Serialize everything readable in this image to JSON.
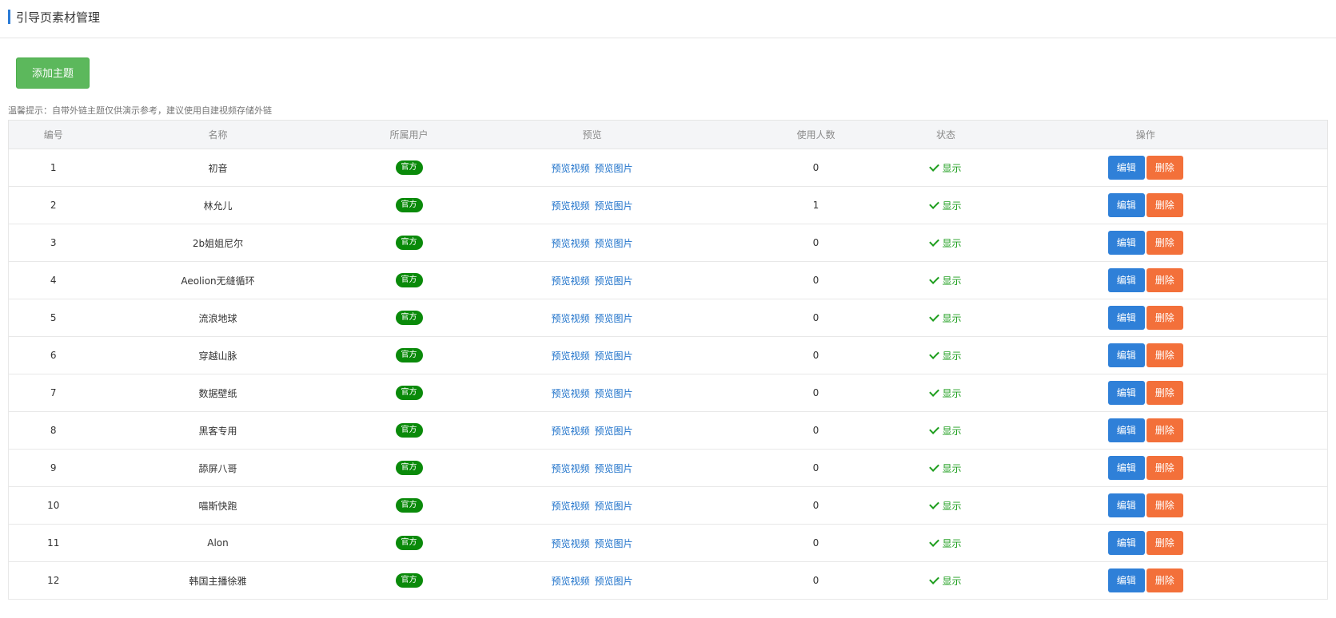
{
  "header": {
    "title": "引导页素材管理"
  },
  "toolbar": {
    "add_label": "添加主题"
  },
  "notice": "温馨提示：自带外链主题仅供演示参考，建议使用自建视频存储外链",
  "table": {
    "columns": [
      "编号",
      "名称",
      "所属用户",
      "预览",
      "使用人数",
      "状态",
      "操作"
    ],
    "rows": [
      {
        "id": "1",
        "name": "初音",
        "owner": "官方",
        "preview_video": "预览视频",
        "preview_image": "预览图片",
        "users": "0",
        "status": "显示",
        "edit": "编辑",
        "delete": "删除"
      },
      {
        "id": "2",
        "name": "林允儿",
        "owner": "官方",
        "preview_video": "预览视频",
        "preview_image": "预览图片",
        "users": "1",
        "status": "显示",
        "edit": "编辑",
        "delete": "删除"
      },
      {
        "id": "3",
        "name": "2b姐姐尼尔",
        "owner": "官方",
        "preview_video": "预览视频",
        "preview_image": "预览图片",
        "users": "0",
        "status": "显示",
        "edit": "编辑",
        "delete": "删除"
      },
      {
        "id": "4",
        "name": "Aeolion无缝循环",
        "owner": "官方",
        "preview_video": "预览视频",
        "preview_image": "预览图片",
        "users": "0",
        "status": "显示",
        "edit": "编辑",
        "delete": "删除"
      },
      {
        "id": "5",
        "name": "流浪地球",
        "owner": "官方",
        "preview_video": "预览视频",
        "preview_image": "预览图片",
        "users": "0",
        "status": "显示",
        "edit": "编辑",
        "delete": "删除"
      },
      {
        "id": "6",
        "name": "穿越山脉",
        "owner": "官方",
        "preview_video": "预览视频",
        "preview_image": "预览图片",
        "users": "0",
        "status": "显示",
        "edit": "编辑",
        "delete": "删除"
      },
      {
        "id": "7",
        "name": "数据壁纸",
        "owner": "官方",
        "preview_video": "预览视频",
        "preview_image": "预览图片",
        "users": "0",
        "status": "显示",
        "edit": "编辑",
        "delete": "删除"
      },
      {
        "id": "8",
        "name": "黑客专用",
        "owner": "官方",
        "preview_video": "预览视频",
        "preview_image": "预览图片",
        "users": "0",
        "status": "显示",
        "edit": "编辑",
        "delete": "删除"
      },
      {
        "id": "9",
        "name": "舔屏八哥",
        "owner": "官方",
        "preview_video": "预览视频",
        "preview_image": "预览图片",
        "users": "0",
        "status": "显示",
        "edit": "编辑",
        "delete": "删除"
      },
      {
        "id": "10",
        "name": "喵斯快跑",
        "owner": "官方",
        "preview_video": "预览视频",
        "preview_image": "预览图片",
        "users": "0",
        "status": "显示",
        "edit": "编辑",
        "delete": "删除"
      },
      {
        "id": "11",
        "name": "Alon",
        "owner": "官方",
        "preview_video": "预览视频",
        "preview_image": "预览图片",
        "users": "0",
        "status": "显示",
        "edit": "编辑",
        "delete": "删除"
      },
      {
        "id": "12",
        "name": "韩国主播徐雅",
        "owner": "官方",
        "preview_video": "预览视频",
        "preview_image": "预览图片",
        "users": "0",
        "status": "显示",
        "edit": "编辑",
        "delete": "删除"
      }
    ]
  }
}
